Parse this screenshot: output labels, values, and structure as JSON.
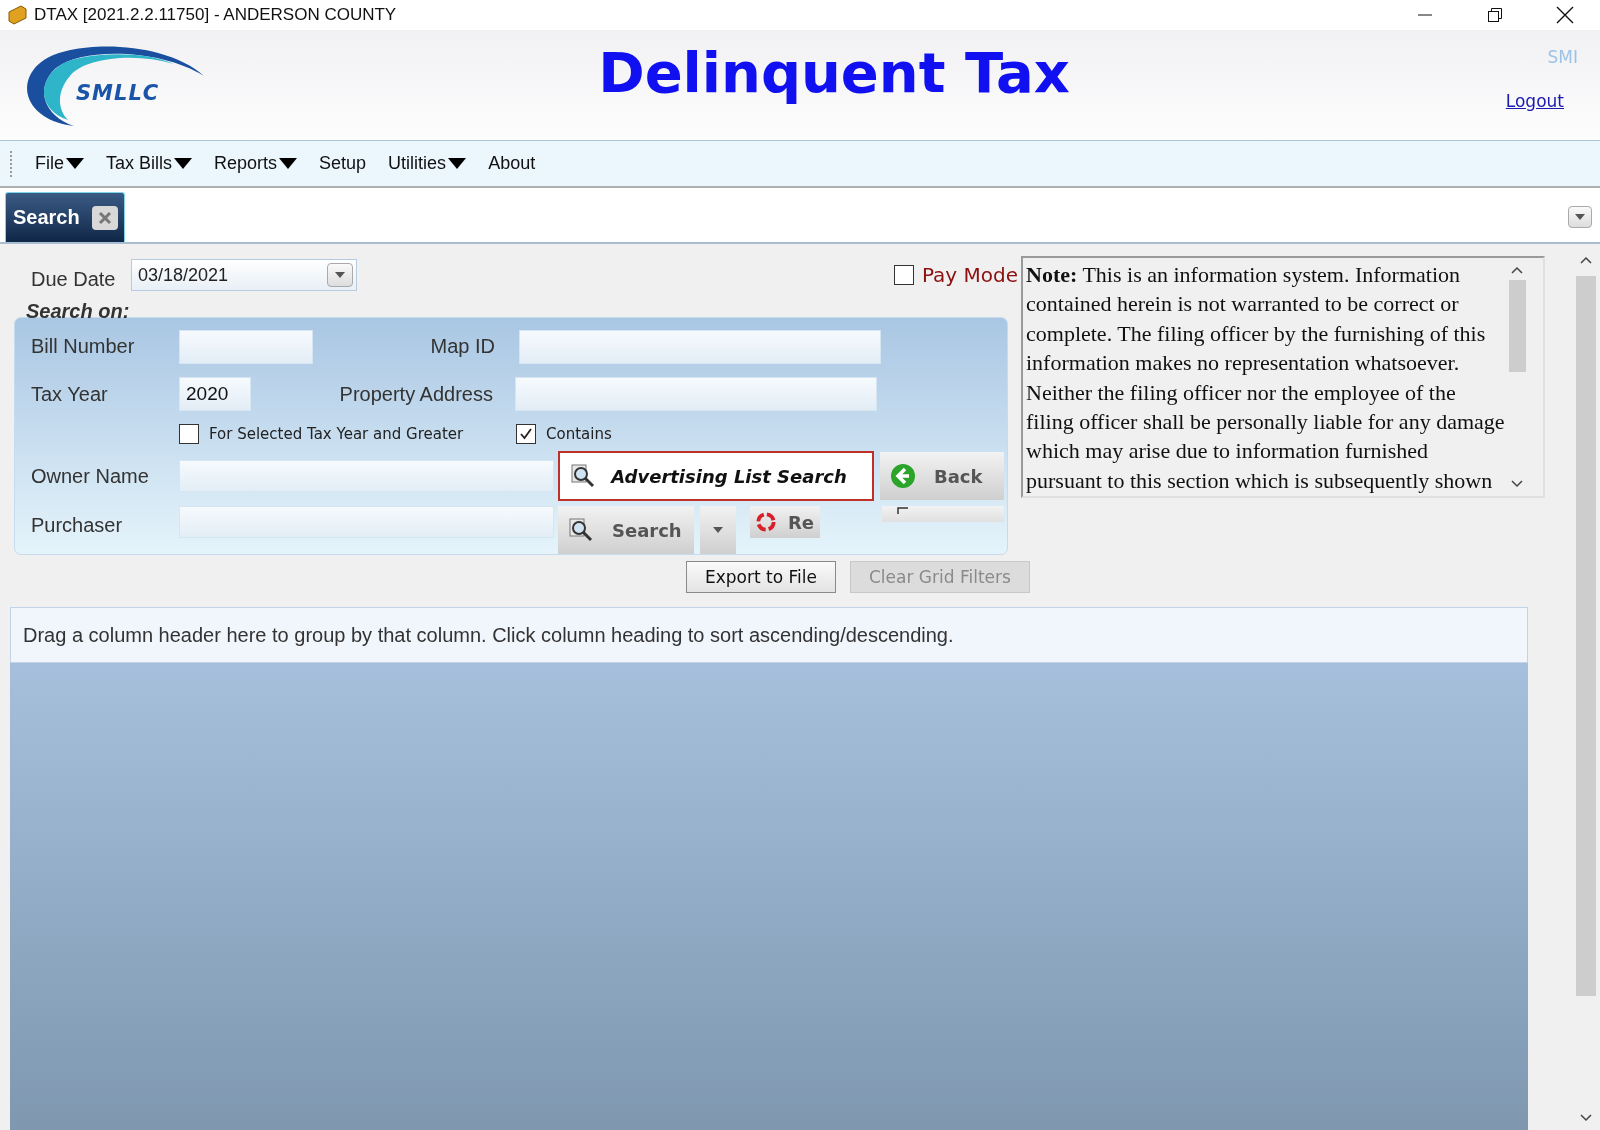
{
  "window": {
    "title": "DTAX [2021.2.2.11750] - ANDERSON COUNTY"
  },
  "header": {
    "logo_text": "SMLLC",
    "title": "Delinquent Tax",
    "user": "SMI",
    "logout": "Logout"
  },
  "menu": [
    {
      "label": "File",
      "dropdown": true
    },
    {
      "label": "Tax Bills",
      "dropdown": true
    },
    {
      "label": "Reports",
      "dropdown": true
    },
    {
      "label": "Setup",
      "dropdown": false
    },
    {
      "label": "Utilities",
      "dropdown": true
    },
    {
      "label": "About",
      "dropdown": false
    }
  ],
  "tabs": [
    {
      "label": "Search",
      "selected": true
    }
  ],
  "due_date": {
    "label": "Due Date",
    "value": "03/18/2021"
  },
  "pay_mode": {
    "label": "Pay Mode",
    "checked": false
  },
  "search_on": {
    "title": "Search on:",
    "bill_number": {
      "label": "Bill Number"
    },
    "map_id": {
      "label": "Map ID"
    },
    "tax_year": {
      "label": "Tax Year",
      "value": "2020"
    },
    "property_address": {
      "label": "Property Address"
    },
    "options": [
      {
        "label": "For Selected Tax Year and Greater",
        "checked": false
      },
      {
        "label": "Contains",
        "checked": true
      }
    ],
    "owner_name": {
      "label": "Owner Name"
    },
    "purchaser": {
      "label": "Purchaser"
    },
    "advertising_button": "Advertising List Search",
    "back_button": "Back",
    "search_button": "Search",
    "reset_button": "Re"
  },
  "note": "**Note:** This is an information system. Information contained herein is not warranted to be correct or complete. The filing officer by the furnishing of this information makes no representation whatsoever. Neither the filing officer nor the employee of the filing officer shall be personally liable for any damage which may arise due to information furnished pursuant to this section which is subsequently shown",
  "grid_buttons": [
    {
      "label": "Export to File",
      "disabled": false
    },
    {
      "label": "Clear Grid Filters",
      "disabled": true
    }
  ],
  "grid": {
    "group_hint": "Drag a column header here to group by that column. Click column heading to sort ascending/descending."
  }
}
